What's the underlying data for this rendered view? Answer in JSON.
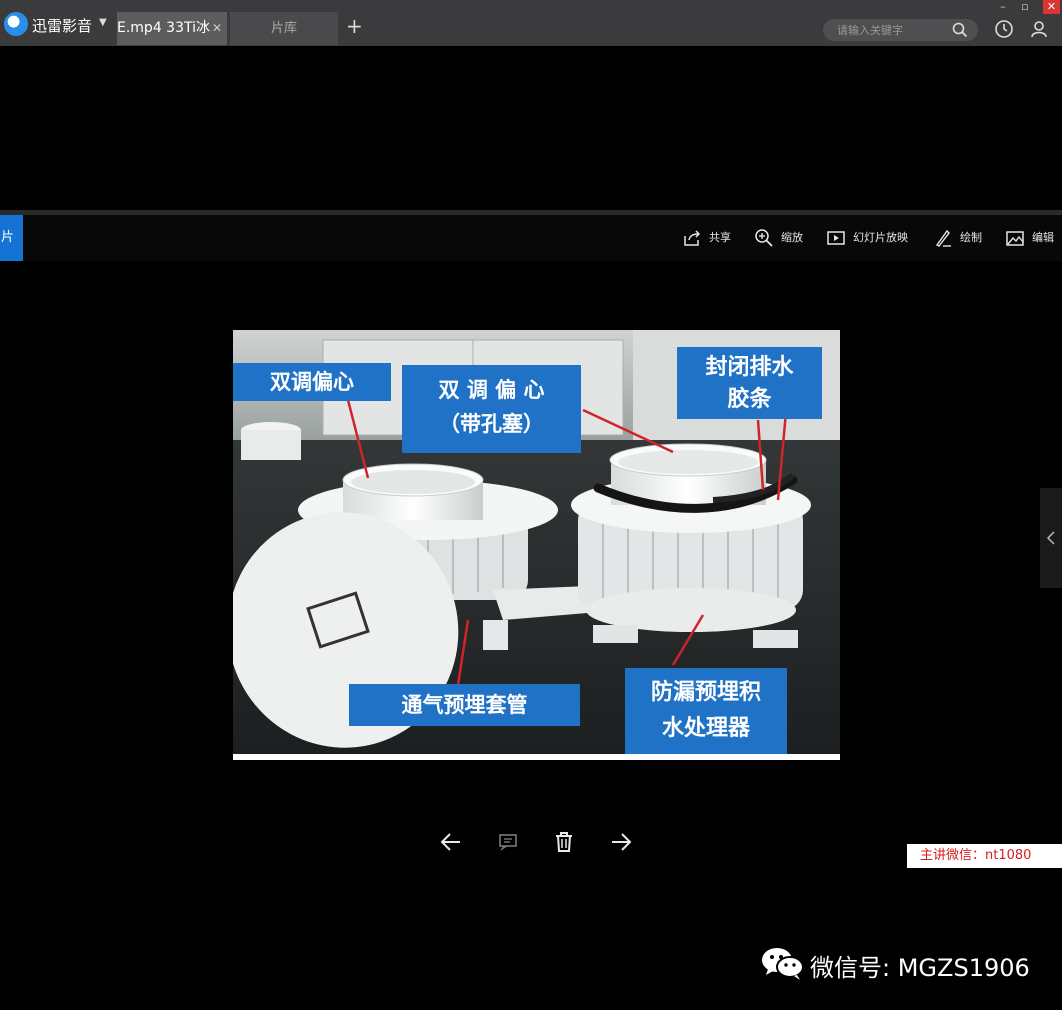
{
  "app": {
    "name": "迅雷影音"
  },
  "tabs": [
    {
      "label": "E.mp4  33Ti冰"
    },
    {
      "label": "片库"
    }
  ],
  "search": {
    "placeholder": "请输入关键字"
  },
  "toolbar": {
    "side_tab": "片",
    "share": "共享",
    "zoom": "缩放",
    "slideshow": "幻灯片放映",
    "draw": "绘制",
    "edit": "编辑"
  },
  "photo_labels": {
    "label1": "双调偏心",
    "label2_line1": "双 调 偏 心",
    "label2_line2": "（带孔塞）",
    "label3_line1": "封闭排水",
    "label3_line2": "胶条",
    "label4": "通气预埋套管",
    "label5_line1": "防漏预埋积",
    "label5_line2": "水处理器"
  },
  "watermark": {
    "red": "主讲微信：nt1080",
    "wechat": "微信号: MGZS1906"
  },
  "colors": {
    "accent": "#1473d4",
    "label_blue": "#1f72c6",
    "watermark_red": "#d62020"
  }
}
